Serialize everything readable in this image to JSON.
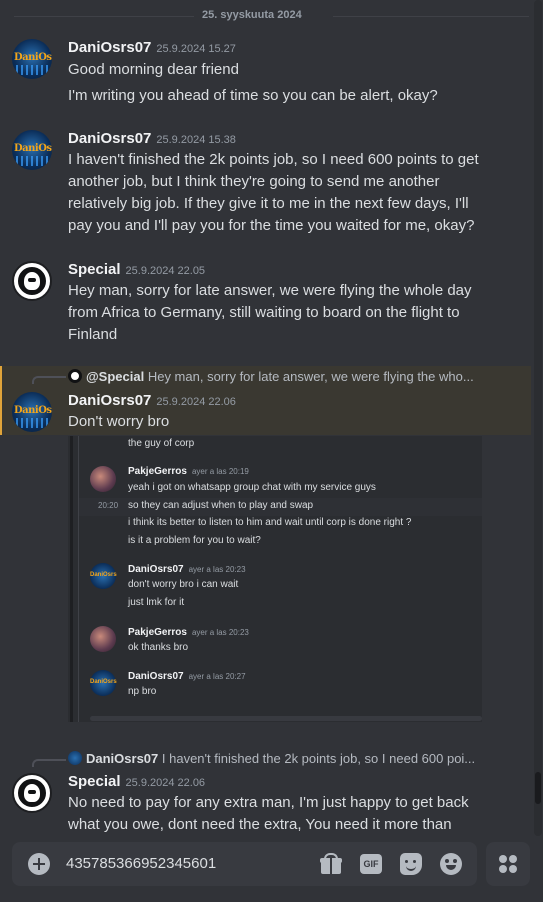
{
  "date_divider": "25. syyskuuta 2024",
  "messages": [
    {
      "username": "DaniOsrs07",
      "timestamp": "25.9.2024 15.27",
      "lines": [
        "Good morning dear friend",
        "I'm writing you ahead of time so you can be alert, okay?"
      ]
    },
    {
      "username": "DaniOsrs07",
      "timestamp": "25.9.2024 15.38",
      "text": "I haven't finished the 2k points job, so I need 600 points to get another job, but I think they're going to send me another relatively big job. If they give it to me in the next few days, I'll pay you and I'll pay you for the time you waited for me, okay?"
    },
    {
      "username": "Special",
      "timestamp": "25.9.2024 22.05",
      "text": "Hey man, sorry for late answer, we were flying the whole day from Africa to Germany, still waiting to board on the flight to Finland"
    },
    {
      "reply_mention": "@Special",
      "reply_preview": "Hey man, sorry for late answer, we were flying the who...",
      "username": "DaniOsrs07",
      "timestamp": "25.9.2024 22.06",
      "text": "Don't worry bro"
    },
    {
      "reply_mention": "DaniOsrs07",
      "reply_preview": "I haven't finished the 2k points job, so I need 600 poi...",
      "username": "Special",
      "timestamp": "25.9.2024 22.06",
      "text": "No need to pay for any extra man, I'm just happy to get back what you owe, dont need the extra, You need it more than"
    }
  ],
  "embed": {
    "top_text": "the guy of corp",
    "blocks": [
      {
        "username": "PakjeGerros",
        "time": "ayer a las 20:19",
        "lines": [
          "yeah i got on whatsapp group chat with my service guys",
          "so they can adjust when to play and swap",
          "i think its better to listen to him and wait until corp is done right ?",
          "is it a problem for you to wait?"
        ],
        "side_time": "20:20"
      },
      {
        "username": "DaniOsrs07",
        "time": "ayer a las 20:23",
        "lines": [
          "don't worry bro i can wait",
          "just lmk for it"
        ]
      },
      {
        "username": "PakjeGerros",
        "time": "ayer a las 20:23",
        "lines": [
          "ok thanks bro"
        ]
      },
      {
        "username": "DaniOsrs07",
        "time": "ayer a las 20:27",
        "lines": [
          "np bro"
        ]
      }
    ]
  },
  "composer": {
    "value": "435785366952345601",
    "gif_label": "GIF"
  },
  "avatar_text": "DaniOsrs",
  "icons": [
    "add-attachment-icon",
    "gift-icon",
    "gif-icon",
    "sticker-icon",
    "emoji-icon",
    "apps-icon"
  ],
  "colors": {
    "background": "#313338",
    "highlight": "#3a3831",
    "highlight_border": "#e0a43a",
    "composer": "#383a40"
  }
}
